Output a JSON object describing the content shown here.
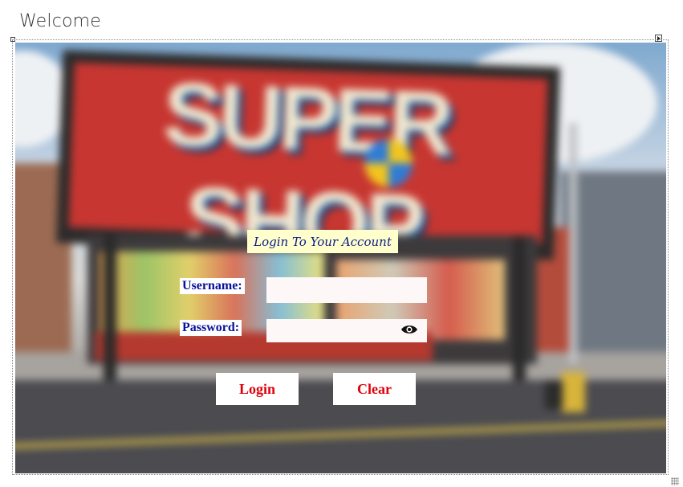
{
  "window": {
    "title": "Welcome"
  },
  "background": {
    "sign_text": "SUPER SHOP",
    "description_icon": "storefront-photo"
  },
  "form": {
    "heading": "Login To Your Account",
    "username_label": "Username:",
    "username_value": "",
    "password_label": "Password:",
    "password_value": "",
    "show_password_icon": "eye-icon",
    "login_label": "Login",
    "clear_label": "Clear"
  },
  "colors": {
    "heading_bg": "#ffffcc",
    "heading_text": "#0a1a8c",
    "label_text": "#06109a",
    "button_text": "#e0000a",
    "input_bg": "#fdf7f7"
  }
}
